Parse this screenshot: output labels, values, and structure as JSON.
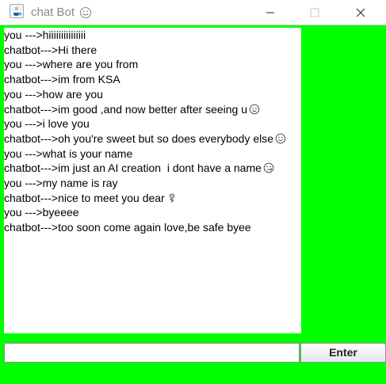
{
  "window": {
    "title": "chat Bot",
    "title_icon": "smiling-face-icon",
    "background_color": "#00ff00"
  },
  "chat": {
    "lines": [
      {
        "text": "you --->hiiiiiiiiiiiiiii"
      },
      {
        "text": "chatbot--->Hi there"
      },
      {
        "text": "you --->where are you from"
      },
      {
        "text": "chatbot--->im from KSA"
      },
      {
        "text": "you --->how are you"
      },
      {
        "text": "chatbot--->im good ,and now better after seeing u",
        "emoji": "slight-smile-icon"
      },
      {
        "text": "you --->i love you"
      },
      {
        "text": "chatbot--->oh you're sweet but so does everybody else",
        "emoji": "smiling-face-icon"
      },
      {
        "text": "you --->what is your name"
      },
      {
        "text": "chatbot--->im just an AI creation  i dont have a name",
        "emoji": "face-with-tear-icon"
      },
      {
        "text": "you --->my name is ray"
      },
      {
        "text": "chatbot--->nice to meet you dear",
        "emoji": "rose-icon"
      },
      {
        "text": "you --->byeeee"
      },
      {
        "text": "chatbot--->too soon come again love,be safe byee"
      }
    ]
  },
  "input": {
    "value": "",
    "button_label": "Enter"
  }
}
